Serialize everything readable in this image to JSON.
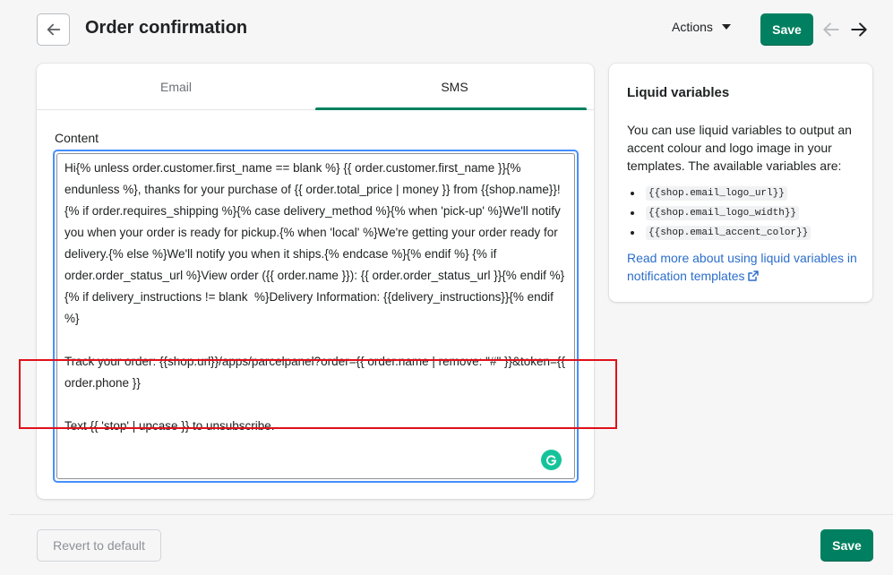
{
  "header": {
    "title": "Order confirmation",
    "actions_label": "Actions",
    "save_label": "Save"
  },
  "tabs": [
    {
      "label": "Email",
      "active": false
    },
    {
      "label": "SMS",
      "active": true
    }
  ],
  "editor": {
    "content_label": "Content",
    "text": "Hi{% unless order.customer.first_name == blank %} {{ order.customer.first_name }}{% endunless %}, thanks for your purchase of {{ order.total_price | money }} from {{shop.name}}! {% if order.requires_shipping %}{% case delivery_method %}{% when 'pick-up' %}We'll notify you when your order is ready for pickup.{% when 'local' %}We're getting your order ready for delivery.{% else %}We'll notify you when it ships.{% endcase %}{% endif %} {% if order.order_status_url %}View order ({{ order.name }}): {{ order.order_status_url }}{% endif %}\n{% if delivery_instructions != blank  %}Delivery Information: {{delivery_instructions}}{% endif %}\n\nTrack your order: {{shop.url}}/apps/parcelpanel?order={{ order.name | remove: \"#\" }}&token={{ order.phone }}\n\nText {{ 'stop' | upcase }} to unsubscribe."
  },
  "sidebar": {
    "title": "Liquid variables",
    "description": "You can use liquid variables to output an accent colour and logo image in your templates. The available variables are:",
    "variables": [
      "{{shop.email_logo_url}}",
      "{{shop.email_logo_width}}",
      "{{shop.email_accent_color}}"
    ],
    "link_text": "Read more about using liquid variables in notification templates"
  },
  "footer": {
    "revert_label": "Revert to default",
    "save_label": "Save"
  },
  "colors": {
    "primary": "#008060",
    "link": "#2c6ecb",
    "focus": "#458fff",
    "annotation": "#e0101a",
    "grammarly": "#15c39a"
  }
}
